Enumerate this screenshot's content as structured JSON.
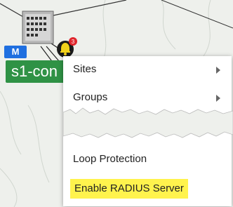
{
  "node": {
    "badge": "M",
    "label": "s1-con",
    "alert_count": "3"
  },
  "menu": {
    "items": [
      {
        "label": "Sites",
        "has_submenu": true
      },
      {
        "label": "Groups",
        "has_submenu": true
      },
      {
        "label": "Loop Protection",
        "has_submenu": false
      },
      {
        "label": "Enable RADIUS Server",
        "has_submenu": false
      }
    ]
  },
  "colors": {
    "badge": "#1f6fe0",
    "node_label": "#2f9245",
    "alert_bell": "#f2d21b",
    "alert_dot": "#e0262d",
    "highlight": "#fff34d"
  }
}
